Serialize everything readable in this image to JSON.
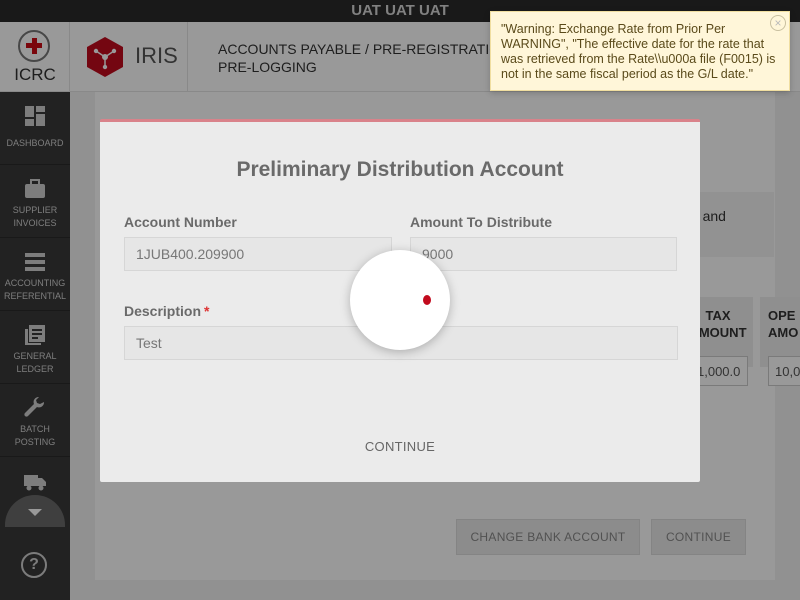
{
  "env_banner": "UAT UAT UAT",
  "header": {
    "org_name": "ICRC",
    "app_name": "IRIS",
    "breadcrumb_line1": "ACCOUNTS PAYABLE / PRE-REGISTRATIO",
    "breadcrumb_line2": "PRE-LOGGING"
  },
  "sidebar": {
    "items": [
      {
        "label": "DASHBOARD",
        "icon": "dashboard-icon"
      },
      {
        "label": "SUPPLIER INVOICES",
        "icon": "briefcase-icon"
      },
      {
        "label": "ACCOUNTING REFERENTIAL",
        "icon": "list-icon"
      },
      {
        "label": "GENERAL LEDGER",
        "icon": "ledger-icon"
      },
      {
        "label": "BATCH POSTING",
        "icon": "wrench-icon"
      },
      {
        "label": "",
        "icon": "truck-icon"
      }
    ],
    "collapse_icon": "chevron-down-icon",
    "help_label": "?"
  },
  "background": {
    "notice_text": "tax and",
    "col_tax_amount": "TAX AMOUNT",
    "col_open_amount": "OPE AMO",
    "tax_amount_value": "1,000.0",
    "open_amount_value": "10,0",
    "change_bank_account_label": "CHANGE BANK ACCOUNT",
    "continue_label": "CONTINUE"
  },
  "modal": {
    "title": "Preliminary Distribution Account",
    "account_number_label": "Account Number",
    "account_number_value": "1JUB400.209900",
    "amount_label": "Amount To Distribute",
    "amount_value": "9000",
    "description_label": "Description",
    "required_marker": "*",
    "description_value": "Test",
    "continue_label": "CONTINUE"
  },
  "toast": {
    "message": "\"Warning: Exchange Rate from Prior Per WARNING\", \"The effective date for the rate that was retrieved from the Rate\\\\u000a file (F0015) is not in the same fiscal period as the G/L date.\"",
    "close_label": "×"
  },
  "colors": {
    "brand_red": "#c20a1d",
    "sidebar_bg": "#3a3a3a",
    "warning_bg": "#fff6d9"
  }
}
